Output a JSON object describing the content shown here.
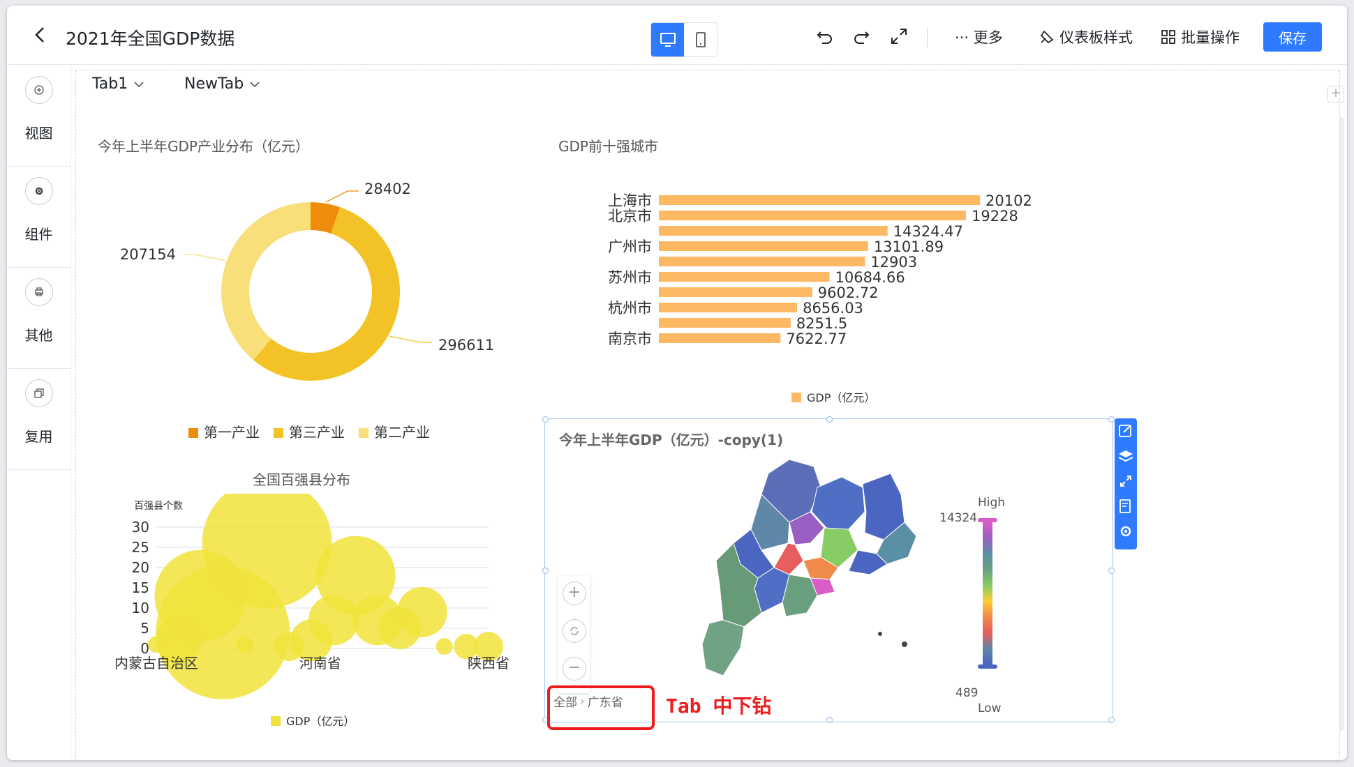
{
  "header": {
    "back_icon": "chevron-left-icon",
    "title": "2021年全国GDP数据",
    "more_label": "··· 更多",
    "dashboard_style_label": "仪表板样式",
    "batch_label": "批量操作",
    "save_label": "保存"
  },
  "sidebar": {
    "items": [
      {
        "label": "视图",
        "icon": "plus-circle-icon"
      },
      {
        "label": "组件",
        "icon": "gear-icon"
      },
      {
        "label": "其他",
        "icon": "printer-icon"
      },
      {
        "label": "复用",
        "icon": "copy-icon"
      }
    ]
  },
  "tabs": [
    "Tab1",
    "NewTab"
  ],
  "colors": {
    "accent": "#2f7bff",
    "donut": [
      "#ef8c0c",
      "#f3c226",
      "#f9df7a"
    ],
    "bars": "#fdb863",
    "bubbles": "#f1e33b",
    "annotation": "#ee1c1c"
  },
  "charts": {
    "donut_title": "今年上半年GDP产业分布（亿元）",
    "bar_title": "GDP前十强城市",
    "scatter_title": "全国百强县分布",
    "map_title": "今年上半年GDP（亿元）-copy(1)"
  },
  "chart_data": [
    {
      "type": "pie",
      "title": "今年上半年GDP产业分布（亿元）",
      "labels": [
        "第一产业",
        "第三产业",
        "第二产业"
      ],
      "values": [
        28402,
        296611,
        207154
      ],
      "legend": "bottom"
    },
    {
      "type": "bar",
      "orientation": "horizontal",
      "title": "GDP前十强城市",
      "categories": [
        "上海市",
        "北京市",
        "",
        "广州市",
        "",
        "苏州市",
        "",
        "杭州市",
        "",
        "南京市"
      ],
      "series": [
        {
          "name": "GDP（亿元）",
          "values": [
            20102,
            19228,
            14324.47,
            13101.89,
            12903,
            10684.66,
            9602.72,
            8656.03,
            8251.5,
            7622.77
          ]
        }
      ],
      "legend": "bottom"
    },
    {
      "type": "scatter",
      "title": "全国百强县分布",
      "ylabel": "百强县个数",
      "categories": [
        "内蒙古自治区",
        "河南省",
        "陕西省"
      ],
      "y_ticks": [
        0,
        5,
        10,
        15,
        20,
        25,
        30
      ],
      "ylim": [
        0,
        30
      ],
      "series": [
        {
          "name": "GDP（亿元）",
          "points": [
            {
              "x": 0,
              "y": 1,
              "r": 0.2
            },
            {
              "x": 0.5,
              "y": 2,
              "r": 0.55
            },
            {
              "x": 1,
              "y": 13,
              "r": 1.1
            },
            {
              "x": 1.5,
              "y": 4,
              "r": 1.6
            },
            {
              "x": 2,
              "y": 1,
              "r": 0.2
            },
            {
              "x": 2.5,
              "y": 26,
              "r": 1.55
            },
            {
              "x": 3,
              "y": 0.5,
              "r": 0.35
            },
            {
              "x": 3.5,
              "y": 2,
              "r": 0.5
            },
            {
              "x": 4,
              "y": 7,
              "r": 0.6
            },
            {
              "x": 4.5,
              "y": 18,
              "r": 0.95
            },
            {
              "x": 5,
              "y": 7,
              "r": 0.6
            },
            {
              "x": 5.5,
              "y": 5,
              "r": 0.5
            },
            {
              "x": 6,
              "y": 9,
              "r": 0.6
            },
            {
              "x": 6.5,
              "y": 0.5,
              "r": 0.2
            },
            {
              "x": 7,
              "y": 0.5,
              "r": 0.3
            },
            {
              "x": 7.5,
              "y": 0.5,
              "r": 0.35
            }
          ]
        }
      ],
      "legend": "bottom"
    }
  ],
  "map": {
    "max_label": "14324",
    "min_label": "489",
    "high_label": "High",
    "low_label": "Low",
    "breadcrumb": [
      "全部",
      "广东省"
    ]
  },
  "annotation": "Tab 中下钻"
}
